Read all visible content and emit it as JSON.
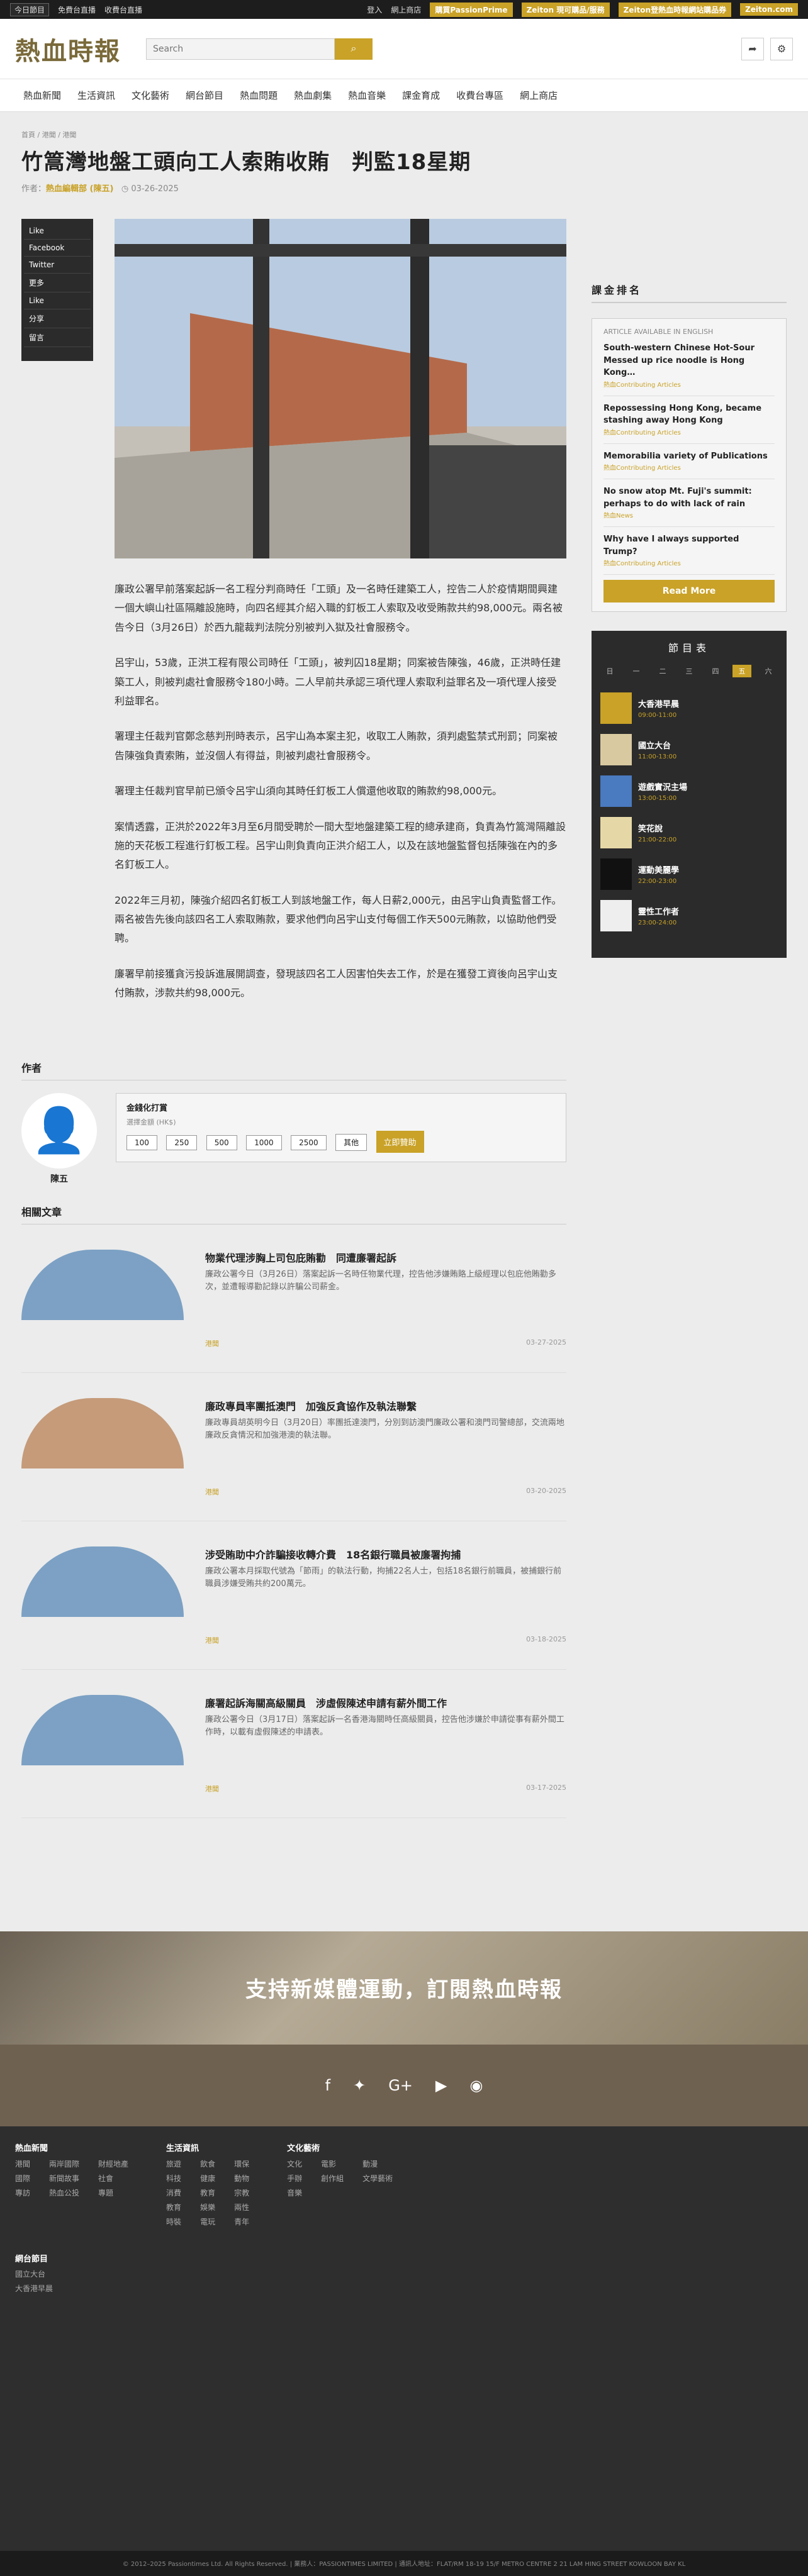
{
  "topbar": {
    "date": "今日節目",
    "left_items": [
      "免費台直播",
      "收費台直播"
    ],
    "login": "登入",
    "shop": "網上商店",
    "btn1": "購買PassionPrime",
    "btn2": "Zeiton 現可購品/服務",
    "btn3": "Zeiton登熱血時報網站購品券",
    "btn4": "Zeiton.com"
  },
  "header": {
    "logo": "熱血時報",
    "search_placeholder": "Search"
  },
  "nav": [
    "熱血新聞",
    "生活資訊",
    "文化藝術",
    "網台節目",
    "熱血問題",
    "熱血劇集",
    "熱血音樂",
    "課金育成",
    "收費台專區",
    "網上商店"
  ],
  "article": {
    "breadcrumb": "首頁 / 港聞 / 港聞",
    "title": "竹篙灣地盤工頭向工人索賄收賄　判監18星期",
    "author_prefix": "作者：",
    "author": "熱血編輯部 (陳五)",
    "date": "03-26-2025",
    "share": [
      "Like",
      "Facebook",
      "Twitter",
      "更多",
      "Like",
      "分享",
      "留言"
    ],
    "paragraphs": [
      "廉政公署早前落案起訴一名工程分判商時任「工頭」及一名時任建築工人，控告二人於疫情期間興建一個大嶼山社區隔離設施時，向四名經其介紹入職的釘板工人索取及收受賄款共約98,000元。兩名被告今日（3月26日）於西九龍裁判法院分別被判入獄及社會服務令。",
      "呂宇山，53歲，正洪工程有限公司時任「工頭」，被判囚18星期；同案被告陳強，46歲，正洪時任建築工人，則被判處社會服務令180小時。二人早前共承認三項代理人索取利益罪名及一項代理人接受利益罪名。",
      "署理主任裁判官鄭念慈判刑時表示，呂宇山為本案主犯，收取工人賄款，須判處監禁式刑罰；同案被告陳強負責索賄，並沒個人有得益，則被判處社會服務令。",
      "署理主任裁判官早前已頒令呂宇山須向其時任釘板工人償還他收取的賄款約98,000元。",
      "案情透露，正洪於2022年3月至6月間受聘於一間大型地盤建築工程的總承建商，負責為竹篙灣隔離設施的天花板工程進行釘板工程。呂宇山則負責向正洪介紹工人，以及在該地盤監督包括陳強在內的多名釘板工人。",
      "2022年三月初，陳強介紹四名釘板工人到該地盤工作，每人日薪2,000元，由呂宇山負責監督工作。兩名被告先後向該四名工人索取賄款，要求他們向呂宇山支付每個工作天500元賄款，以協助他們受聘。",
      "廉署早前接獲貪污投訴進展開調查，發現該四名工人因害怕失去工作，於是在獲發工資後向呂宇山支付賄款，涉款共約98,000元。"
    ]
  },
  "author_section": {
    "heading": "作者",
    "name": "陳五",
    "donate_title": "金錢化打賞",
    "donate_sub": "選擇金額 (HK$)",
    "amounts": [
      "100",
      "250",
      "500",
      "1000",
      "2500",
      "其他"
    ],
    "donate_btn": "立即贊助"
  },
  "related": {
    "heading": "相關文章",
    "items": [
      {
        "title": "物業代理涉胸上司包庇賄勸　同遭廉署起訴",
        "desc": "廉政公署今日（3月26日）落案起訴一名時任物業代理，控告他涉嫌賄賂上級經理以包庇他賄勸多次，並遭報導勸記錄以許騙公司薪金。",
        "cat": "港聞",
        "date": "03-27-2025"
      },
      {
        "title": "廉政專員率團抵澳門　加強反貪協作及執法聯繫",
        "desc": "廉政專員胡英明今日（3月20日）率團抵達澳門，分別到訪澳門廉政公署和澳門司警總部，交流兩地廉政反貪情況和加強港澳的執法聯。",
        "cat": "港聞",
        "date": "03-20-2025"
      },
      {
        "title": "涉受賄助中介詐騙接收轉介費　18名銀行職員被廉署拘捕",
        "desc": "廉政公署本月採取代號為「節雨」的執法行動，拘捕22名人士，包括18名銀行前職員，被捕銀行前職員涉嫌受賄共約200萬元。",
        "cat": "港聞",
        "date": "03-18-2025"
      },
      {
        "title": "廉署起訴海關高級關員　涉虛假陳述申請有薪外間工作",
        "desc": "廉政公署今日（3月17日）落案起訴一名香港海關時任高級關員，控告他涉嫌於申請從事有薪外間工作時，以載有虛假陳述的申請表。",
        "cat": "港聞",
        "date": "03-17-2025"
      }
    ]
  },
  "sidebar": {
    "heading": "課金排名",
    "box_header": "ARTICLE AVAILABLE IN ENGLISH",
    "articles": [
      {
        "title": "South-western Chinese Hot-Sour Messed up rice noodle is Hong Kong…",
        "tag": "熱血Contributing Articles"
      },
      {
        "title": "Repossessing Hong Kong, became stashing away Hong Kong",
        "tag": "熱血Contributing Articles"
      },
      {
        "title": "Memorabilia variety of Publications",
        "tag": "熱血Contributing Articles"
      },
      {
        "title": "No snow atop Mt. Fuji's summit: perhaps to do with lack of rain",
        "tag": "熱血News"
      },
      {
        "title": "Why have I always supported Trump?",
        "tag": "熱血Contributing Articles"
      }
    ],
    "read_more": "Read More",
    "schedule_title": "節目表",
    "days": [
      "日",
      "一",
      "二",
      "三",
      "四",
      "五",
      "六"
    ],
    "programs": [
      {
        "name": "大香港早晨",
        "time": "09:00-11:00"
      },
      {
        "name": "國立大台",
        "time": "11:00-13:00"
      },
      {
        "name": "遊戲實況主場",
        "time": "13:00-15:00"
      },
      {
        "name": "笑花說",
        "time": "21:00-22:00"
      },
      {
        "name": "運動美麗學",
        "time": "22:00-23:00"
      },
      {
        "name": "靈性工作者",
        "time": "23:00-24:00"
      }
    ]
  },
  "banner": "支持新媒體運動，訂閱熱血時報",
  "footer": {
    "col1_title": "熱血新聞",
    "col1": [
      "港聞",
      "國際",
      "專訪",
      "兩岸國際",
      "新聞故事",
      "熱血公投",
      "財經地產",
      "社會",
      "專題"
    ],
    "col2_title": "生活資訊",
    "col2": [
      "旅遊",
      "科技",
      "消費",
      "教育",
      "時裝",
      "飲食",
      "健康",
      "教育",
      "娛樂",
      "電玩",
      "環保",
      "動物",
      "宗教",
      "兩性",
      "青年"
    ],
    "col3_title": "文化藝術",
    "col3": [
      "文化",
      "手辦",
      "音樂",
      "電影",
      "創作組",
      "動漫",
      "文學藝術"
    ],
    "net_title": "網台節目",
    "net": [
      "國立大台",
      "大香港早晨"
    ],
    "copyright": "© 2012–2025 Passiontimes Ltd. All Rights Reserved. | 業務人：PASSIONTIMES LIMITED | 通訊人地址：FLAT/RM 18-19 15/F METRO CENTRE 2 21 LAM HING STREET KOWLOON BAY KL"
  }
}
